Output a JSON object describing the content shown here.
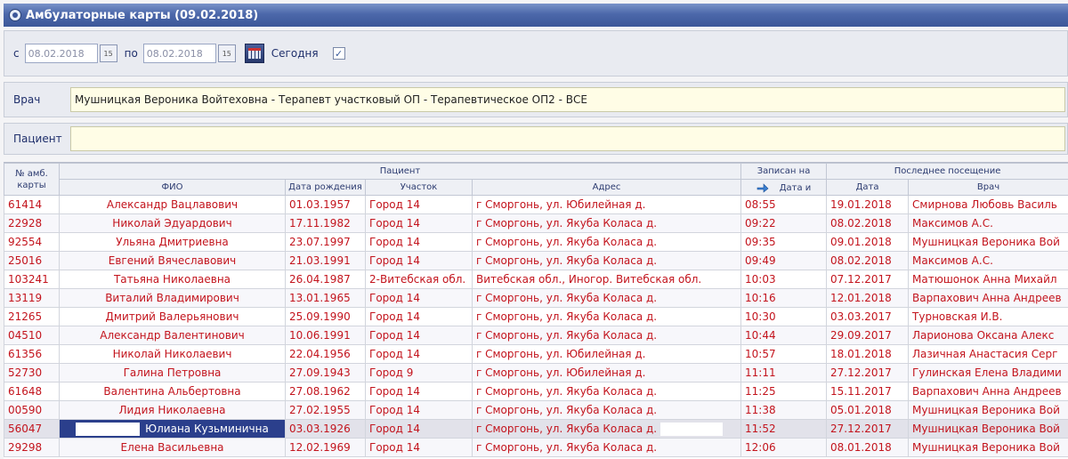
{
  "window": {
    "title": "Амбулаторные карты (09.02.2018)"
  },
  "date_filter": {
    "from_label": "с",
    "from_value": "08.02.2018",
    "to_label": "по",
    "to_value": "08.02.2018",
    "today_label": "Сегодня",
    "today_checked": true
  },
  "doctor": {
    "label": "Врач",
    "value": "Мушницкая Вероника Войтеховна - Терапевт участковый ОП - Терапевтическое ОП2 - ВСЕ"
  },
  "patient": {
    "label": "Пациент",
    "value": ""
  },
  "table": {
    "group_headers": {
      "card_no": "№ амб. карты",
      "patient": "Пациент",
      "scheduled": "Записан на",
      "last_visit": "Последнее посещение"
    },
    "columns": {
      "fio": "ФИО",
      "birth_date": "Дата рождения",
      "district": "Участок",
      "address": "Адрес",
      "scheduled_time": "Дата и",
      "last_date": "Дата",
      "last_doctor": "Врач"
    },
    "rows": [
      {
        "num": "61414",
        "fio": "Александр Вацлавович",
        "dob": "01.03.1957",
        "district": "Город 14",
        "address": "г Сморгонь, ул. Юбилейная д.",
        "time": "08:55",
        "last_date": "19.01.2018",
        "last_doctor": "Смирнова Любовь Василь"
      },
      {
        "num": "22928",
        "fio": "Николай Эдуардович",
        "dob": "17.11.1982",
        "district": "Город 14",
        "address": "г Сморгонь, ул. Якуба Коласа д.",
        "time": "09:22",
        "last_date": "08.02.2018",
        "last_doctor": "Максимов А.С."
      },
      {
        "num": "92554",
        "fio": "Ульяна Дмитриевна",
        "dob": "23.07.1997",
        "district": "Город 14",
        "address": "г Сморгонь, ул. Якуба Коласа д.",
        "time": "09:35",
        "last_date": "09.01.2018",
        "last_doctor": "Мушницкая Вероника Вой"
      },
      {
        "num": "25016",
        "fio": "Евгений Вячеславович",
        "dob": "21.03.1991",
        "district": "Город 14",
        "address": "г Сморгонь, ул. Якуба Коласа д.",
        "time": "09:49",
        "last_date": "08.02.2018",
        "last_doctor": "Максимов А.С."
      },
      {
        "num": "103241",
        "fio": "Татьяна Николаевна",
        "dob": "26.04.1987",
        "district": "2-Витебская обл.",
        "address": "Витебская обл., Иногор. Витебская обл.",
        "time": "10:03",
        "last_date": "07.12.2017",
        "last_doctor": "Матюшонок Анна Михайл"
      },
      {
        "num": "13119",
        "fio": "Виталий Владимирович",
        "dob": "13.01.1965",
        "district": "Город 14",
        "address": "г Сморгонь, ул. Якуба Коласа д.",
        "time": "10:16",
        "last_date": "12.01.2018",
        "last_doctor": "Варпахович Анна Андреев"
      },
      {
        "num": "21265",
        "fio": "Дмитрий Валерьянович",
        "dob": "25.09.1990",
        "district": "Город 14",
        "address": "г Сморгонь, ул. Якуба Коласа д.",
        "time": "10:30",
        "last_date": "03.03.2017",
        "last_doctor": "Турновская И.В."
      },
      {
        "num": "04510",
        "fio": "Александр Валентинович",
        "dob": "10.06.1991",
        "district": "Город 14",
        "address": "г Сморгонь, ул. Якуба Коласа д.",
        "time": "10:44",
        "last_date": "29.09.2017",
        "last_doctor": "Ларионова Оксана Алекс"
      },
      {
        "num": "61356",
        "fio": "Николай Николаевич",
        "dob": "22.04.1956",
        "district": "Город 14",
        "address": "г Сморгонь, ул. Юбилейная д.",
        "time": "10:57",
        "last_date": "18.01.2018",
        "last_doctor": "Лазичная Анастасия Серг"
      },
      {
        "num": "52730",
        "fio": "Галина Петровна",
        "dob": "27.09.1943",
        "district": "Город 9",
        "address": "г Сморгонь, ул. Юбилейная д.",
        "time": "11:11",
        "last_date": "27.12.2017",
        "last_doctor": "Гулинская Елена Владими"
      },
      {
        "num": "61648",
        "fio": "Валентина Альбертовна",
        "dob": "27.08.1962",
        "district": "Город 14",
        "address": "г Сморгонь, ул. Якуба Коласа д.",
        "time": "11:25",
        "last_date": "15.11.2017",
        "last_doctor": "Варпахович Анна Андреев"
      },
      {
        "num": "00590",
        "fio": "Лидия Николаевна",
        "dob": "27.02.1955",
        "district": "Город 14",
        "address": "г Сморгонь, ул. Якуба Коласа д.",
        "time": "11:38",
        "last_date": "05.01.2018",
        "last_doctor": "Мушницкая Вероника Вой"
      },
      {
        "num": "56047",
        "fio": "Юлиана Кузьминична",
        "dob": "03.03.1926",
        "district": "Город 14",
        "address": "г Сморгонь, ул. Якуба Коласа д.",
        "time": "11:52",
        "last_date": "27.12.2017",
        "last_doctor": "Мушницкая Вероника Вой",
        "selected": true
      },
      {
        "num": "29298",
        "fio": "Елена Васильевна",
        "dob": "12.02.1969",
        "district": "Город 14",
        "address": "г Сморгонь, ул. Якуба Коласа д.",
        "time": "12:06",
        "last_date": "08.01.2018",
        "last_doctor": "Мушницкая Вероника Вой"
      }
    ]
  },
  "colors": {
    "title_bar": "#4c68aa",
    "row_text": "#c3141d",
    "selection": "#2b3f8c",
    "field_bg": "#fffde6"
  },
  "icons": [
    "window-icon",
    "calendar-icon",
    "checkbox-check-icon",
    "sort-arrow-icon"
  ]
}
